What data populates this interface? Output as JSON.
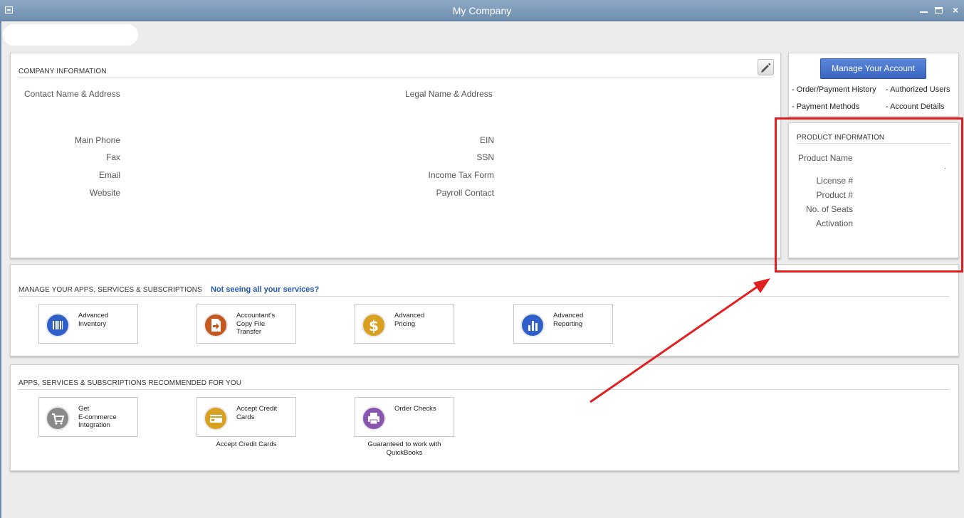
{
  "window": {
    "title": "My Company",
    "controls": {
      "minimize": "_",
      "maximize": "□",
      "close": "×"
    }
  },
  "company_info": {
    "section_title": "COMPANY INFORMATION",
    "left_heading": "Contact Name & Address",
    "left_fields": [
      "Main Phone",
      "Fax",
      "Email",
      "Website"
    ],
    "right_heading": "Legal Name & Address",
    "right_fields": [
      "EIN",
      "SSN",
      "Income Tax Form",
      "Payroll Contact"
    ]
  },
  "account": {
    "manage_button": "Manage Your Account",
    "links": [
      "- Order/Payment History",
      "- Authorized Users",
      "- Payment Methods",
      "- Account Details"
    ]
  },
  "product_info": {
    "section_title": "PRODUCT INFORMATION",
    "product_name_label": "Product Name",
    "fields": [
      "License #",
      "Product #",
      "No. of Seats",
      "Activation"
    ],
    "dot": "."
  },
  "manage_apps": {
    "section_title": "MANAGE YOUR APPS, SERVICES & SUBSCRIPTIONS",
    "link": "Not seeing all your services?",
    "tiles": [
      {
        "label_lines": [
          "Advanced",
          "Inventory"
        ],
        "icon": "barcode-icon",
        "color": "#2f5fc8"
      },
      {
        "label_lines": [
          "Accountant's",
          "Copy File",
          "Transfer"
        ],
        "icon": "file-transfer-icon",
        "color": "#c4581e"
      },
      {
        "label_lines": [
          "Advanced",
          "Pricing"
        ],
        "icon": "dollar-icon",
        "color": "#d9a021"
      },
      {
        "label_lines": [
          "Advanced",
          "Reporting"
        ],
        "icon": "bar-chart-icon",
        "color": "#2f5fc8"
      }
    ]
  },
  "recommended": {
    "section_title": "APPS, SERVICES & SUBSCRIPTIONS RECOMMENDED FOR YOU",
    "tiles": [
      {
        "label_lines": [
          "Get",
          "E-commerce",
          "Integration"
        ],
        "icon": "shopping-cart-icon",
        "color": "#8a8a8a",
        "caption": []
      },
      {
        "label_lines": [
          "Accept Credit",
          "Cards"
        ],
        "icon": "credit-card-icon",
        "color": "#d9a021",
        "caption": [
          "Accept Credit Cards"
        ]
      },
      {
        "label_lines": [
          "Order Checks"
        ],
        "icon": "printer-icon",
        "color": "#8a55b0",
        "caption": [
          "Guaranteed to work with",
          "QuickBooks"
        ]
      }
    ]
  },
  "annotation": {
    "highlight_color": "#e02020"
  }
}
